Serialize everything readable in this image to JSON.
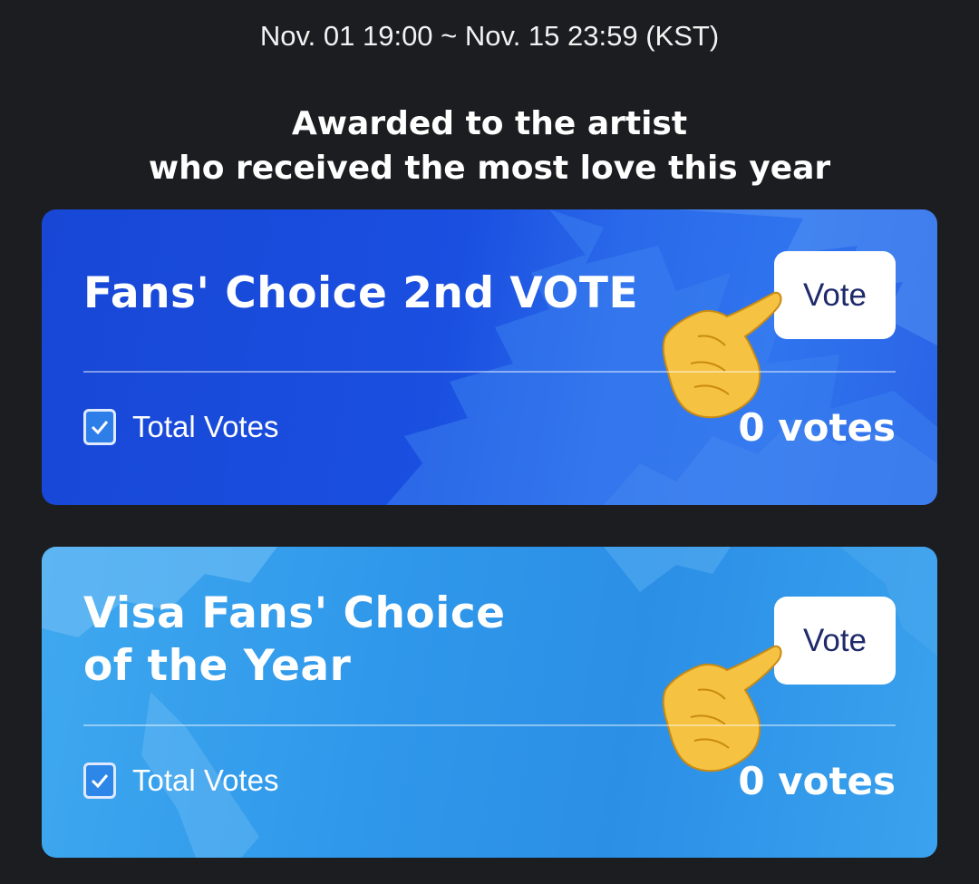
{
  "header": {
    "period": "Nov. 01 19:00 ~ Nov. 15 23:59 (KST)",
    "subtitle_line1": "Awarded to the artist",
    "subtitle_line2": "who received the most love this year"
  },
  "cards": [
    {
      "title_line1": "Fans' Choice 2nd VOTE",
      "title_line2": "",
      "vote_label": "Vote",
      "total_label": "Total Votes",
      "votes_text": "0 votes",
      "checked": true,
      "accent": "#1a4fe0"
    },
    {
      "title_line1": "Visa Fans' Choice",
      "title_line2": "of the Year",
      "vote_label": "Vote",
      "total_label": "Total Votes",
      "votes_text": "0 votes",
      "checked": true,
      "accent": "#2f97ea"
    }
  ],
  "icons": {
    "checkbox": "checkbox-checked-icon",
    "hand": "pointing-hand-icon"
  }
}
